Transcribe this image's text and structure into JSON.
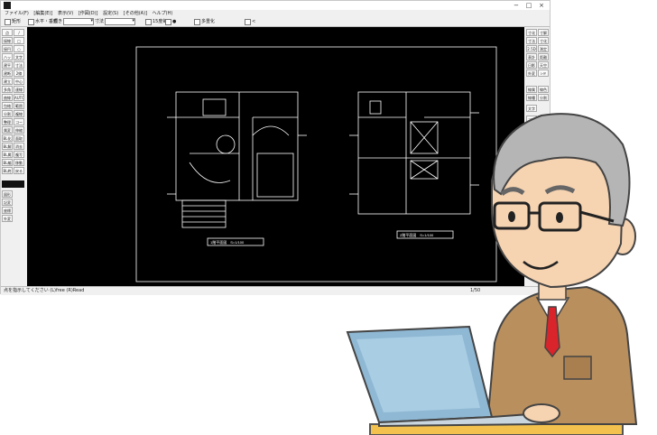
{
  "window": {
    "app_icon": "jw-cad-icon",
    "controls": [
      "−",
      "□",
      "×"
    ]
  },
  "menubar": {
    "items": [
      "ファイル(F)",
      "[編集(E)]",
      "表示(V)",
      "[作図(D)]",
      "設定(S)",
      "[その他(A)]",
      "ヘルプ(H)"
    ]
  },
  "toolbar": {
    "items": [
      "矩形",
      "水平・垂直",
      "傾き",
      "寸法",
      "15度毎",
      "●",
      "多重化",
      "<"
    ]
  },
  "left_tools": [
    "点",
    "/",
    "接線",
    "□",
    "接円",
    "○",
    "ハッチ",
    "文字",
    "建平",
    "寸法",
    "建断",
    "2線",
    "建立",
    "中心線",
    "多角形",
    "連線",
    "曲線",
    "AUTO",
    "包絡",
    "範囲",
    "分割",
    "複線",
    "整理",
    "コーナー",
    "属変",
    "伸縮",
    "BL化",
    "面取",
    "BL解",
    "消去",
    "BL属",
    "複写",
    "BL編",
    "移動",
    "BL終",
    "戻る",
    "図形",
    "",
    "記変",
    "",
    "座標",
    "",
    "外変",
    "",
    "天空",
    "",
    "日影",
    "",
    "2.5D",
    "",
    "測定",
    "",
    "表計"
  ],
  "right_tools": [
    "寸化",
    "寸解",
    "寸法",
    "寸化",
    "2.5D",
    "測定",
    "表計",
    "距離",
    "日影",
    "天空",
    "外変",
    "ﾚｲﾔ",
    "線属",
    "線色",
    "線種",
    "分割",
    "文字",
    "コピ",
    "貼付"
  ],
  "status": {
    "message": "点を指示してください (L)free (R)Read",
    "scale": "1/50"
  },
  "drawing": {
    "plan_label_1": "1階平面図　S=1/100",
    "plan_label_2": "2階平面図　S=1/100"
  },
  "colors": {
    "canvas": "#000000",
    "drawing_lines": "#ffffff",
    "chrome": "#f0f0f0",
    "jacket": "#b98f5e",
    "tie": "#d9242b",
    "laptop": "#8fb8d4"
  }
}
